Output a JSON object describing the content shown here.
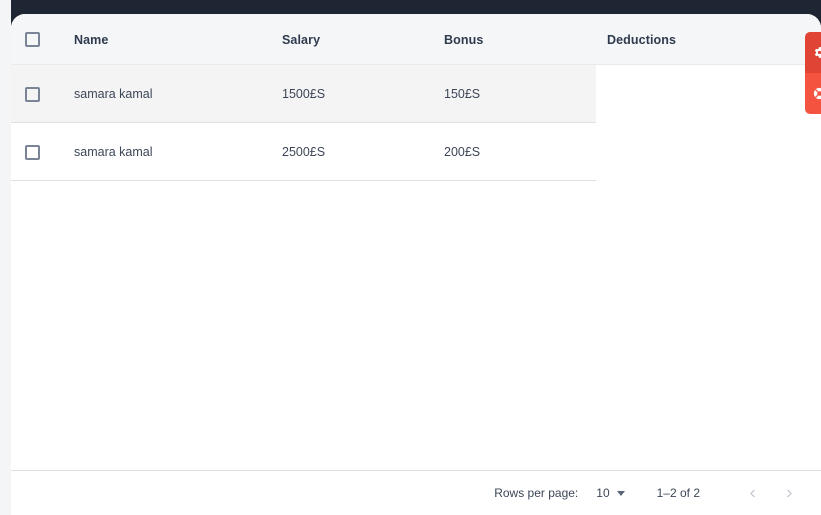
{
  "theme": {
    "app_background": "#1e2633",
    "card_background": "#ffffff",
    "header_background": "#f5f6f8",
    "row_tint": "#f4f4f4",
    "divider": "#dfe0e2",
    "text_primary": "#3d4657",
    "text_header": "#2e3b4e",
    "accent_red_dark": "#e04434",
    "accent_red": "#f4543f"
  },
  "table": {
    "select_all_checkbox": "unchecked",
    "columns": [
      {
        "key": "name",
        "label": "Name"
      },
      {
        "key": "salary",
        "label": "Salary"
      },
      {
        "key": "bonus",
        "label": "Bonus"
      },
      {
        "key": "deductions",
        "label": "Deductions"
      }
    ],
    "rows": [
      {
        "selected": false,
        "highlighted": true,
        "name": "samara kamal",
        "salary": "1500£S",
        "bonus": "150£S",
        "deductions": ""
      },
      {
        "selected": false,
        "highlighted": false,
        "name": "samara kamal",
        "salary": "2500£S",
        "bonus": "200£S",
        "deductions": ""
      }
    ]
  },
  "footer": {
    "rows_per_page_label": "Rows per page:",
    "rows_per_page_value": "10",
    "rows_per_page_options": [
      "10"
    ],
    "range_label": "1–2 of 2",
    "prev_page_icon": "chevron-left-icon",
    "next_page_icon": "chevron-right-icon",
    "prev_enabled": false,
    "next_enabled": false
  },
  "floating_actions": [
    {
      "name": "settings",
      "icon": "gear-icon",
      "color": "#e04434"
    },
    {
      "name": "support",
      "icon": "lifebuoy-icon",
      "color": "#f4543f"
    }
  ]
}
